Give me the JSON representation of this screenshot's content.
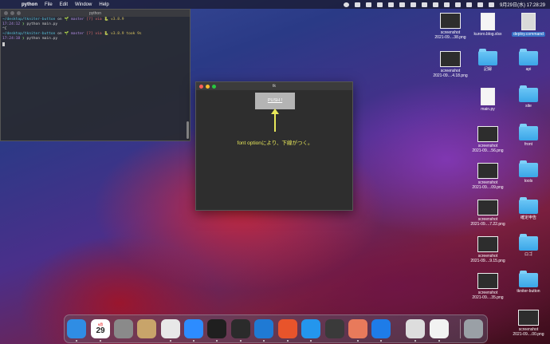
{
  "menubar": {
    "app_name": "python",
    "items": [
      "File",
      "Edit",
      "Window",
      "Help"
    ],
    "clock": "9月29日(水) 17:28:29"
  },
  "terminal": {
    "title": "python",
    "lines": [
      {
        "path": "~/desktop/tkniter-button",
        "on": " on ",
        "branch": "🌱 master",
        "state": " [?] via ",
        "py": "🐍 v3.8.9",
        "tail": ""
      },
      {
        "time": "17:24:12",
        "prompt": " ❯ ",
        "cmd": "python main.py"
      },
      {
        "plain": "^C"
      },
      {
        "path": "~/desktop/tkniter-button",
        "on": " on ",
        "branch": "🌱 master",
        "state": " [?] via ",
        "py": "🐍 v3.8.9",
        "tail": " took 9s"
      },
      {
        "time": "17:24:18",
        "prompt": " ❯ ",
        "cmd": "python main.py"
      }
    ]
  },
  "tk_window": {
    "title": "tk",
    "button_label": "PUSH !",
    "annotation": "font optionにより、下線がつく。",
    "annotation_color": "#e8e85a"
  },
  "desktop_icons": [
    {
      "label": "screenshot\n2021-09....38.png",
      "kind": "thumb"
    },
    {
      "label": "kuroro.blog.xlsx",
      "kind": "doc"
    },
    {
      "label": "deploy.command",
      "kind": "doc-dark",
      "selected": true
    },
    {
      "label": "screenshot\n2021-09....4.18.png",
      "kind": "thumb"
    },
    {
      "label": "記録",
      "kind": "folder"
    },
    {
      "label": "api",
      "kind": "folder"
    },
    {
      "label": "main.py",
      "kind": "doc"
    },
    {
      "label": "site",
      "kind": "folder"
    },
    {
      "label": "screenshot\n2021-09....56.png",
      "kind": "thumb"
    },
    {
      "label": "front",
      "kind": "folder"
    },
    {
      "label": "screenshot\n2021-09....09.png",
      "kind": "thumb"
    },
    {
      "label": "tools",
      "kind": "folder"
    },
    {
      "label": "screenshot\n2021-09....7.22.png",
      "kind": "thumb"
    },
    {
      "label": "確定申告",
      "kind": "folder"
    },
    {
      "label": "screenshot\n2021-09....9.15.png",
      "kind": "thumb"
    },
    {
      "label": "ロゴ",
      "kind": "folder"
    },
    {
      "label": "screenshot\n2021-09....35.png",
      "kind": "thumb"
    },
    {
      "label": "tkniter-button",
      "kind": "folder"
    },
    {
      "label": "screenshot\n2021-09....00.png",
      "kind": "thumb"
    }
  ],
  "dock": {
    "calendar_month": "9月",
    "calendar_day": "29",
    "apps": [
      {
        "name": "finder-icon",
        "color": "#2f8de4"
      },
      {
        "name": "calendar-icon",
        "color": "#ffffff"
      },
      {
        "name": "system-preferences-icon",
        "color": "#8a8a8a"
      },
      {
        "name": "contacts-icon",
        "color": "#c8a46a"
      },
      {
        "name": "chrome-icon",
        "color": "#e8e8e8"
      },
      {
        "name": "zoom-icon",
        "color": "#2d8cff"
      },
      {
        "name": "terminal-icon",
        "color": "#1f1f1f"
      },
      {
        "name": "terminal-alt-icon",
        "color": "#2b2b2b"
      },
      {
        "name": "vscode-icon",
        "color": "#1f7ad4"
      },
      {
        "name": "analytics-icon",
        "color": "#e8542b"
      },
      {
        "name": "docker-icon",
        "color": "#2496ed"
      },
      {
        "name": "quicktime-icon",
        "color": "#3a3a3a"
      },
      {
        "name": "preview-icon",
        "color": "#e87a5b"
      },
      {
        "name": "infinity-app-icon",
        "color": "#1e7ce8"
      },
      {
        "name": "photos-window-icon",
        "color": "#dddddd"
      },
      {
        "name": "document-icon",
        "color": "#f2f2f2"
      },
      {
        "name": "trash-icon",
        "color": "#9aa0a6"
      }
    ]
  }
}
